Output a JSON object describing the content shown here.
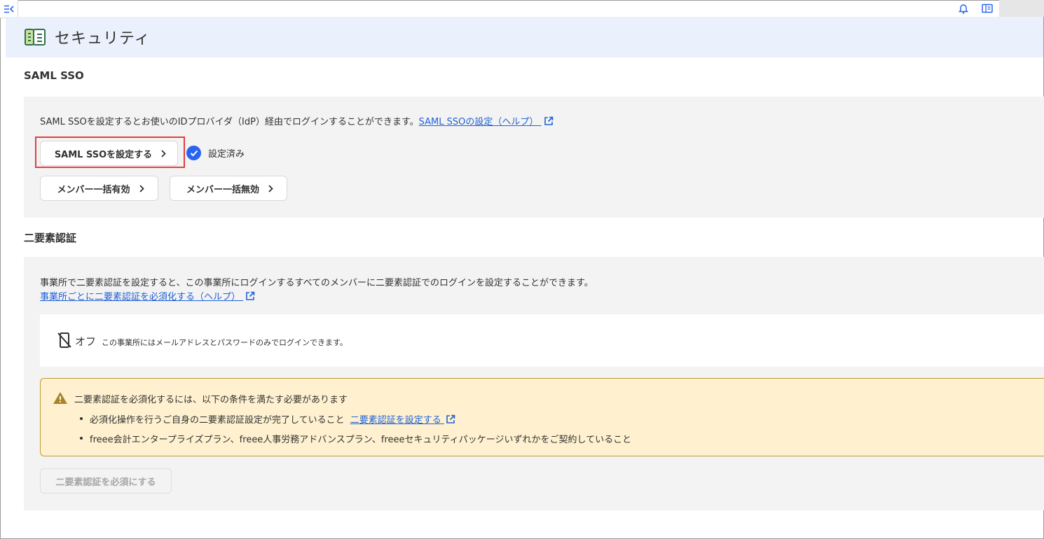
{
  "page": {
    "title": "セキュリティ"
  },
  "saml": {
    "section_title": "SAML SSO",
    "description": "SAML SSOを設定するとお使いのIDプロバイダ（IdP）経由でログインすることができます。",
    "help_link": "SAML SSOの設定（ヘルプ）",
    "configure_button": "SAML SSOを設定する",
    "status": "設定済み",
    "bulk_enable_button": "メンバー一括有効",
    "bulk_disable_button": "メンバー一括無効"
  },
  "twofa": {
    "section_title": "二要素認証",
    "description": "事業所で二要素認証を設定すると、この事業所にログインするすべてのメンバーに二要素認証でのログインを設定することができます。",
    "help_link": "事業所ごとに二要素認証を必須化する（ヘルプ）",
    "state_label": "オフ",
    "state_description": "この事業所にはメールアドレスとパスワードのみでログインできます。",
    "warning": {
      "title": "二要素認証を必須化するには、以下の条件を満たす必要があります",
      "item1_text": "必須化操作を行うご自身の二要素認証設定が完了していること",
      "item1_link": "二要素認証を設定する",
      "item2_text": "freee会計エンタープライズプラン、freee人事労務アドバンスプラン、freeeセキュリティパッケージいずれかをご契約していること"
    },
    "require_button": "二要素認証を必須にする"
  },
  "colors": {
    "accent": "#2864f0",
    "link": "#1f61d6",
    "highlight": "#e0403f",
    "warning_bg": "#fff1cf",
    "header_bg": "#eaf1fc"
  },
  "icons": [
    "sidebar-toggle-icon",
    "bell-icon",
    "company-switch-icon",
    "security-icon",
    "external-link-icon",
    "chevron-right-icon",
    "check-circle-icon",
    "phone-off-icon",
    "warning-icon"
  ]
}
